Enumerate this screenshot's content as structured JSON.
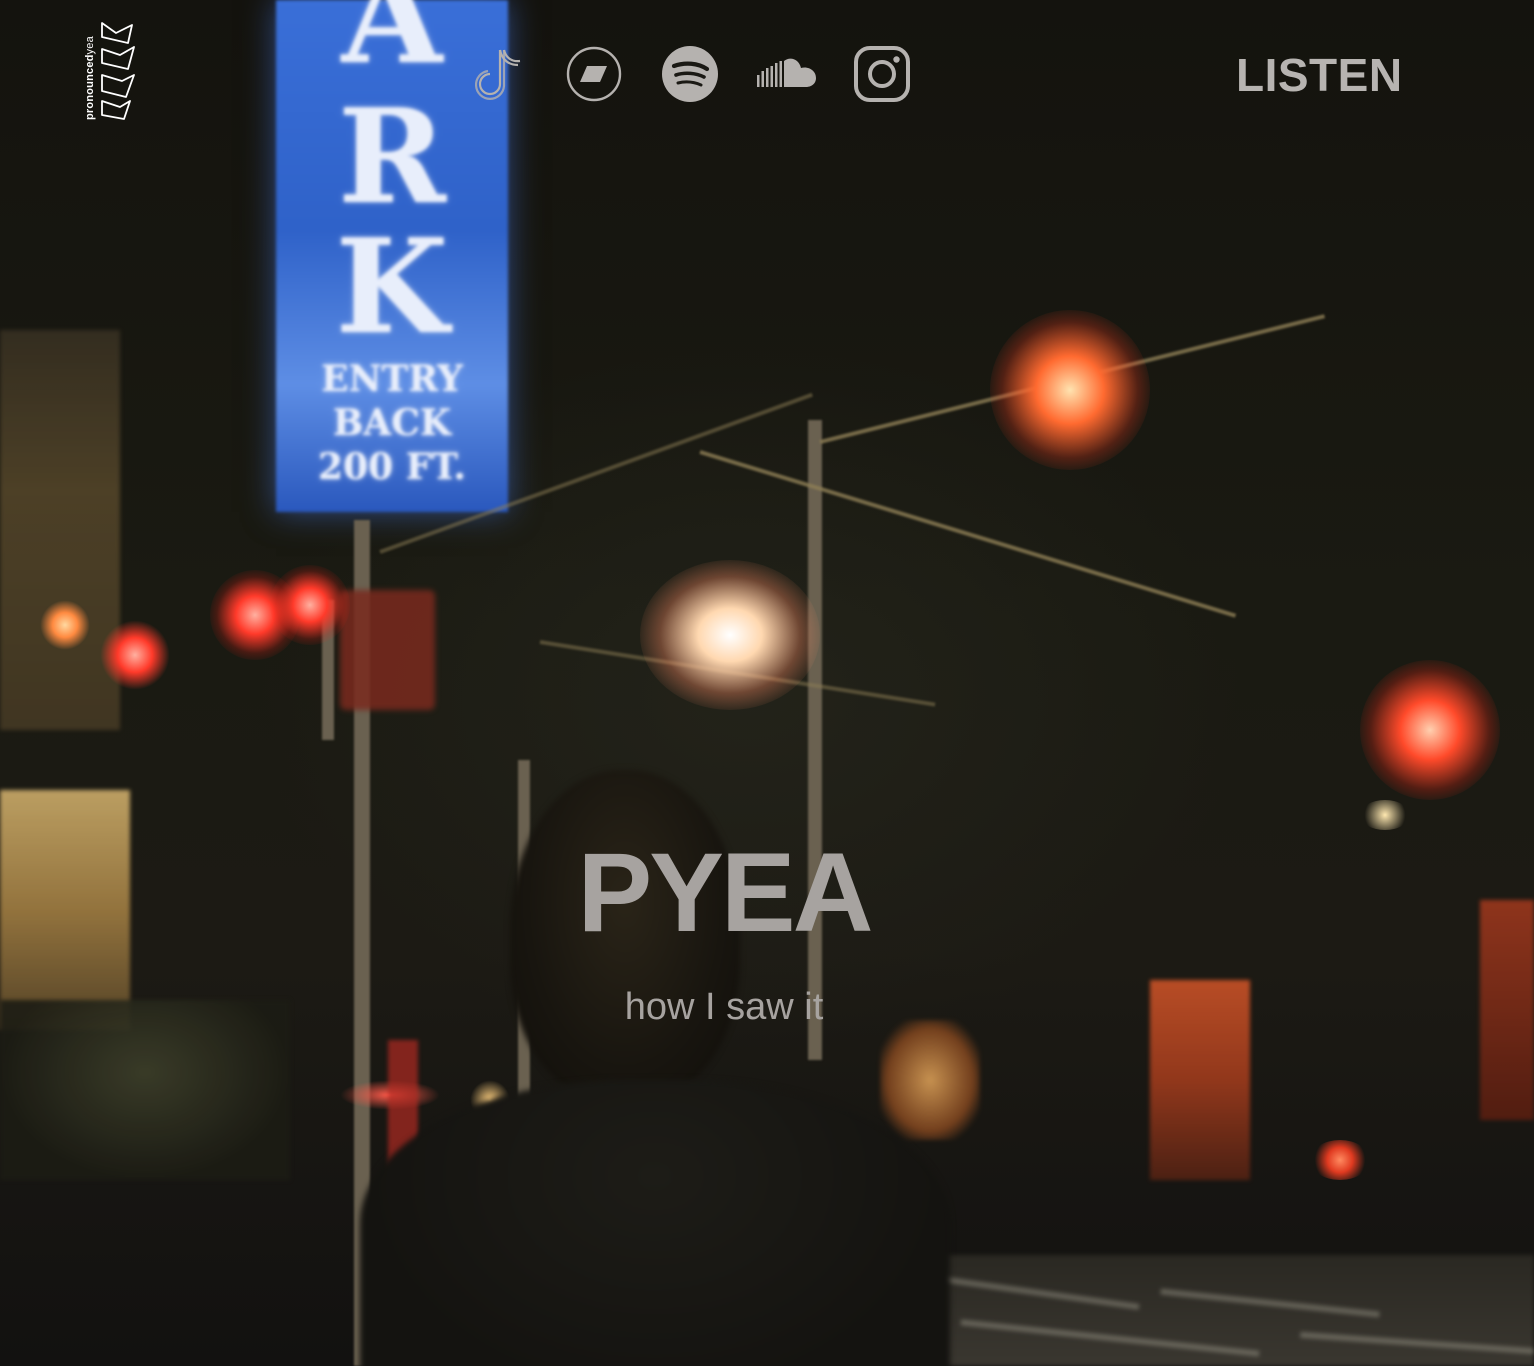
{
  "brand": {
    "logo_text_bold": "pronounced",
    "logo_text_light": "yea",
    "logo_icon": "wave-stack-icon"
  },
  "nav": {
    "social_links": [
      {
        "name": "tiktok",
        "icon": "tiktok-icon"
      },
      {
        "name": "bandcamp",
        "icon": "bandcamp-icon"
      },
      {
        "name": "spotify",
        "icon": "spotify-icon"
      },
      {
        "name": "soundcloud",
        "icon": "soundcloud-icon"
      },
      {
        "name": "instagram",
        "icon": "instagram-icon"
      }
    ],
    "listen_label": "LISTEN"
  },
  "hero": {
    "artist": "PYEA",
    "release": "how I saw it"
  },
  "background_sign": {
    "letters": [
      "A",
      "R",
      "K"
    ],
    "line1": "ENTRY",
    "line2": "BACK",
    "line3": "200 FT."
  },
  "colors": {
    "text_overlay": "#a7a3a0",
    "listen": "#b7b4b1",
    "icon": "#b5b2af",
    "sign_blue": "#3a6fd8",
    "street_light": "#ff5a2a"
  }
}
